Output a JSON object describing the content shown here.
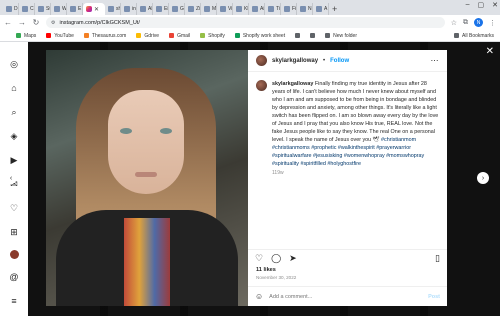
{
  "browser": {
    "tabs": [
      {
        "title": "D"
      },
      {
        "title": "Ch"
      },
      {
        "title": "St"
      },
      {
        "title": "W"
      },
      {
        "title": "E"
      },
      {
        "title": "",
        "active": true
      },
      {
        "title": "sh"
      },
      {
        "title": "in"
      },
      {
        "title": "Al"
      },
      {
        "title": "Ei"
      },
      {
        "title": "G"
      },
      {
        "title": "Zi"
      },
      {
        "title": "M"
      },
      {
        "title": "Vi"
      },
      {
        "title": "Kl"
      },
      {
        "title": "Ai"
      },
      {
        "title": "Ti"
      },
      {
        "title": "Fi"
      },
      {
        "title": "N"
      },
      {
        "title": "A"
      }
    ],
    "url": "instagram.com/p/ClkGCKSM_Ut/",
    "profile_initial": "N",
    "bookmarks": [
      {
        "label": "Maps",
        "color": "#34a853"
      },
      {
        "label": "YouTube",
        "color": "#ff0000"
      },
      {
        "label": "Thesaurus.com",
        "color": "#f48024"
      },
      {
        "label": "Gdrive",
        "color": "#fbbc04"
      },
      {
        "label": "Gmail",
        "color": "#ea4335"
      },
      {
        "label": "Shopify",
        "color": "#95bf47"
      },
      {
        "label": "Shopify work sheet",
        "color": "#0f9d58"
      },
      {
        "label": "",
        "color": "#5f6368"
      },
      {
        "label": "",
        "color": "#5f6368"
      },
      {
        "label": "New folder",
        "color": "#5f6368"
      }
    ],
    "all_bookmarks": "All Bookmarks"
  },
  "post": {
    "username": "skylarkgalloway",
    "follow_label": "Follow",
    "caption": "Finally finding my true identity in Jesus after 28 years of life. I can't believe how much I never knew about myself and who I am and am supposed to be from being in bondage and blinded by depression and anxiety, among other things. It's literally like a light switch has been flipped on. I am so blown away every day by the love of Jesus and I pray that you also know His true, REAL love. Not the fake Jesus people like to say they know. The real One on a personal level. I speak the name of Jesus over you 🕊",
    "hashtags": "#christianmom #christianmoms #prophetic #walkinthespirit #prayerwarrior #spiritualwarfare #jesusisking #womenwhopray #momswhopray #spirituality #spiritfilled #holyghostfire",
    "caption_age": "119w",
    "likes": "11 likes",
    "date": "November 30, 2022",
    "comment_placeholder": "Add a comment...",
    "post_label": "Post"
  }
}
